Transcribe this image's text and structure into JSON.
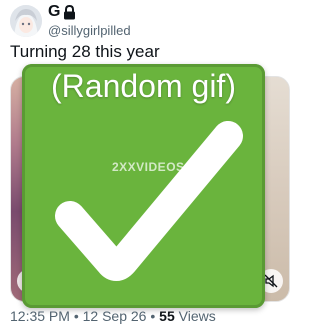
{
  "author": {
    "name": "G",
    "handle": "@sillygirlpilled"
  },
  "tweet": {
    "text": "Turning 28 this year"
  },
  "overlay": {
    "caption": "(Random gif)",
    "watermark": "2XXVIDEOS.COM"
  },
  "meta": {
    "time": "12:35 PM",
    "separator1": " • ",
    "date": "12 Sep 26",
    "separator2": " • ",
    "views_count": "55",
    "views_label": " Views"
  },
  "colors": {
    "checkbox_green": "#6ab43d",
    "text_primary": "#0f1419",
    "text_secondary": "#536471"
  },
  "icons": [
    "lock-icon",
    "gif-icon",
    "mute-icon",
    "checkmark-icon"
  ]
}
